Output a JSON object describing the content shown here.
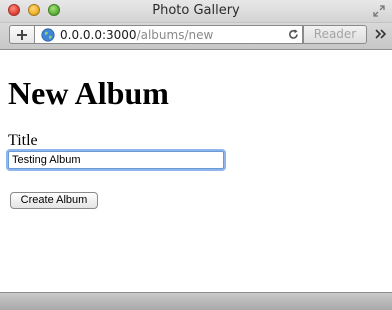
{
  "window": {
    "title": "Photo Gallery"
  },
  "toolbar": {
    "url_host": "0.0.0.0:3000",
    "url_path": "/albums/new",
    "reader_label": "Reader",
    "icons": [
      "plus-icon",
      "globe-icon",
      "reload-icon",
      "resize-icon",
      "overflow-chevron-icon"
    ]
  },
  "page": {
    "heading": "New Album",
    "form": {
      "title_label": "Title",
      "title_value": "Testing Album",
      "submit_label": "Create Album"
    }
  },
  "colors": {
    "focus_ring": "#8db6ea",
    "close": "#e0443a",
    "minimize": "#f0b22a",
    "maximize": "#5db33b"
  }
}
